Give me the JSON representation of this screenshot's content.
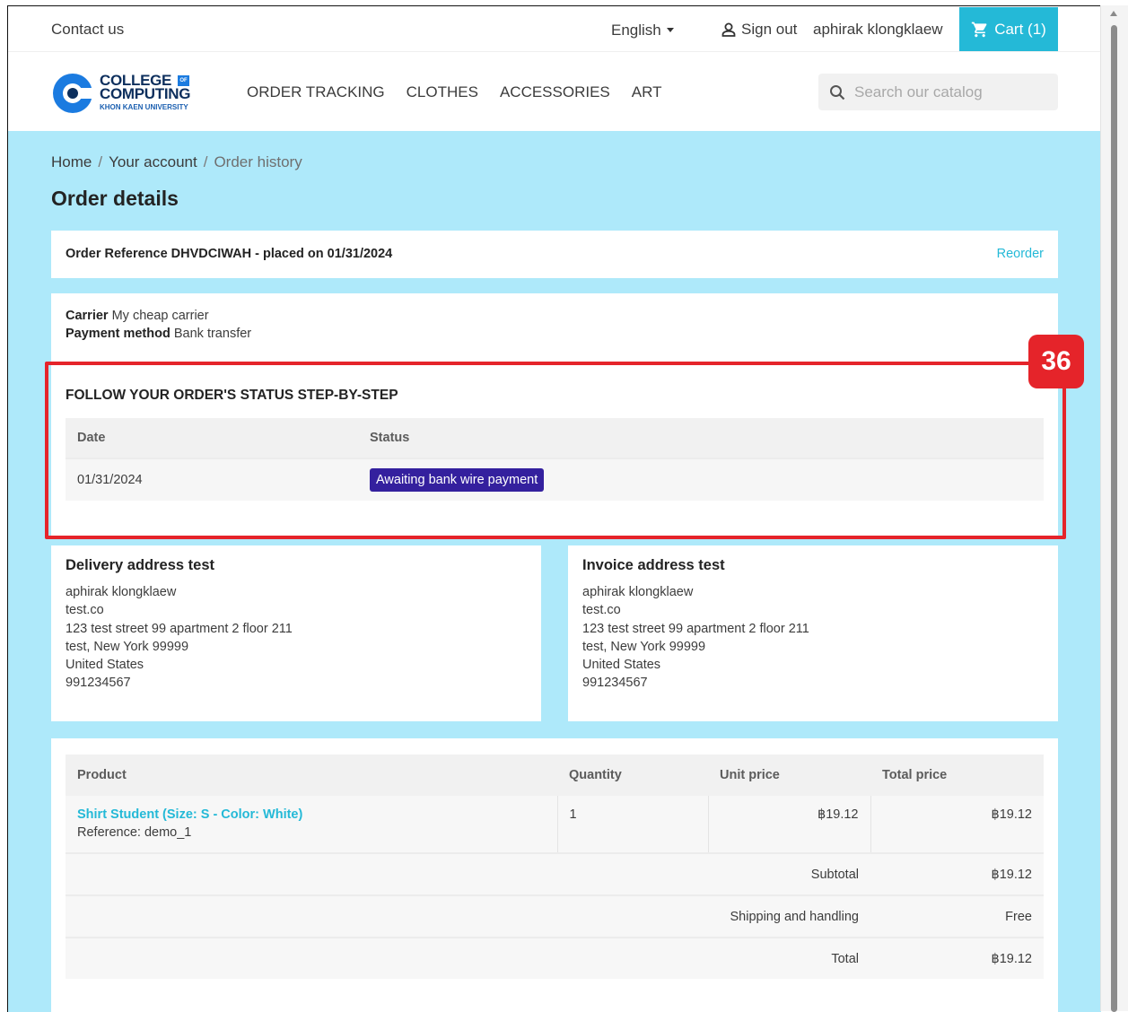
{
  "topbar": {
    "contact": "Contact us",
    "language": "English",
    "sign_out": "Sign out",
    "username": "aphirak klongklaew",
    "cart": "Cart (1)"
  },
  "header": {
    "logo_line1": "COLLEGE",
    "logo_of": "OF",
    "logo_line2": "COMPUTING",
    "logo_line3": "KHON KAEN UNIVERSITY",
    "nav": [
      "ORDER TRACKING",
      "CLOTHES",
      "ACCESSORIES",
      "ART"
    ],
    "search_placeholder": "Search our catalog"
  },
  "breadcrumb": [
    "Home",
    "Your account",
    "Order history"
  ],
  "page_title": "Order details",
  "order": {
    "reference_text": "Order Reference DHVDCIWAH - placed on 01/31/2024",
    "reorder": "Reorder",
    "carrier_label": "Carrier",
    "carrier_value": "My cheap carrier",
    "payment_label": "Payment method",
    "payment_value": "Bank transfer"
  },
  "status_section": {
    "title": "FOLLOW YOUR ORDER'S STATUS STEP-BY-STEP",
    "headers": [
      "Date",
      "Status"
    ],
    "rows": [
      {
        "date": "01/31/2024",
        "status": "Awaiting bank wire payment",
        "status_color": "#34209e"
      }
    ],
    "annotation": "36"
  },
  "delivery_address": {
    "title": "Delivery address test",
    "lines": [
      "aphirak klongklaew",
      "test.co",
      "123 test street 99 apartment 2 floor 211",
      "test, New York 99999",
      "United States",
      "991234567"
    ]
  },
  "invoice_address": {
    "title": "Invoice address test",
    "lines": [
      "aphirak klongklaew",
      "test.co",
      "123 test street 99 apartment 2 floor 211",
      "test, New York 99999",
      "United States",
      "991234567"
    ]
  },
  "products": {
    "headers": [
      "Product",
      "Quantity",
      "Unit price",
      "Total price"
    ],
    "items": [
      {
        "name": "Shirt Student (Size: S - Color: White)",
        "reference": "Reference: demo_1",
        "quantity": "1",
        "unit_price": "฿19.12",
        "total_price": "฿19.12"
      }
    ],
    "summary": [
      {
        "label": "Subtotal",
        "value": "฿19.12"
      },
      {
        "label": "Shipping and handling",
        "value": "Free"
      },
      {
        "label": "Total",
        "value": "฿19.12"
      }
    ]
  },
  "colors": {
    "accent": "#24b9d7",
    "background": "#aee9fa",
    "highlight": "#e5242a",
    "status_badge": "#34209e"
  }
}
